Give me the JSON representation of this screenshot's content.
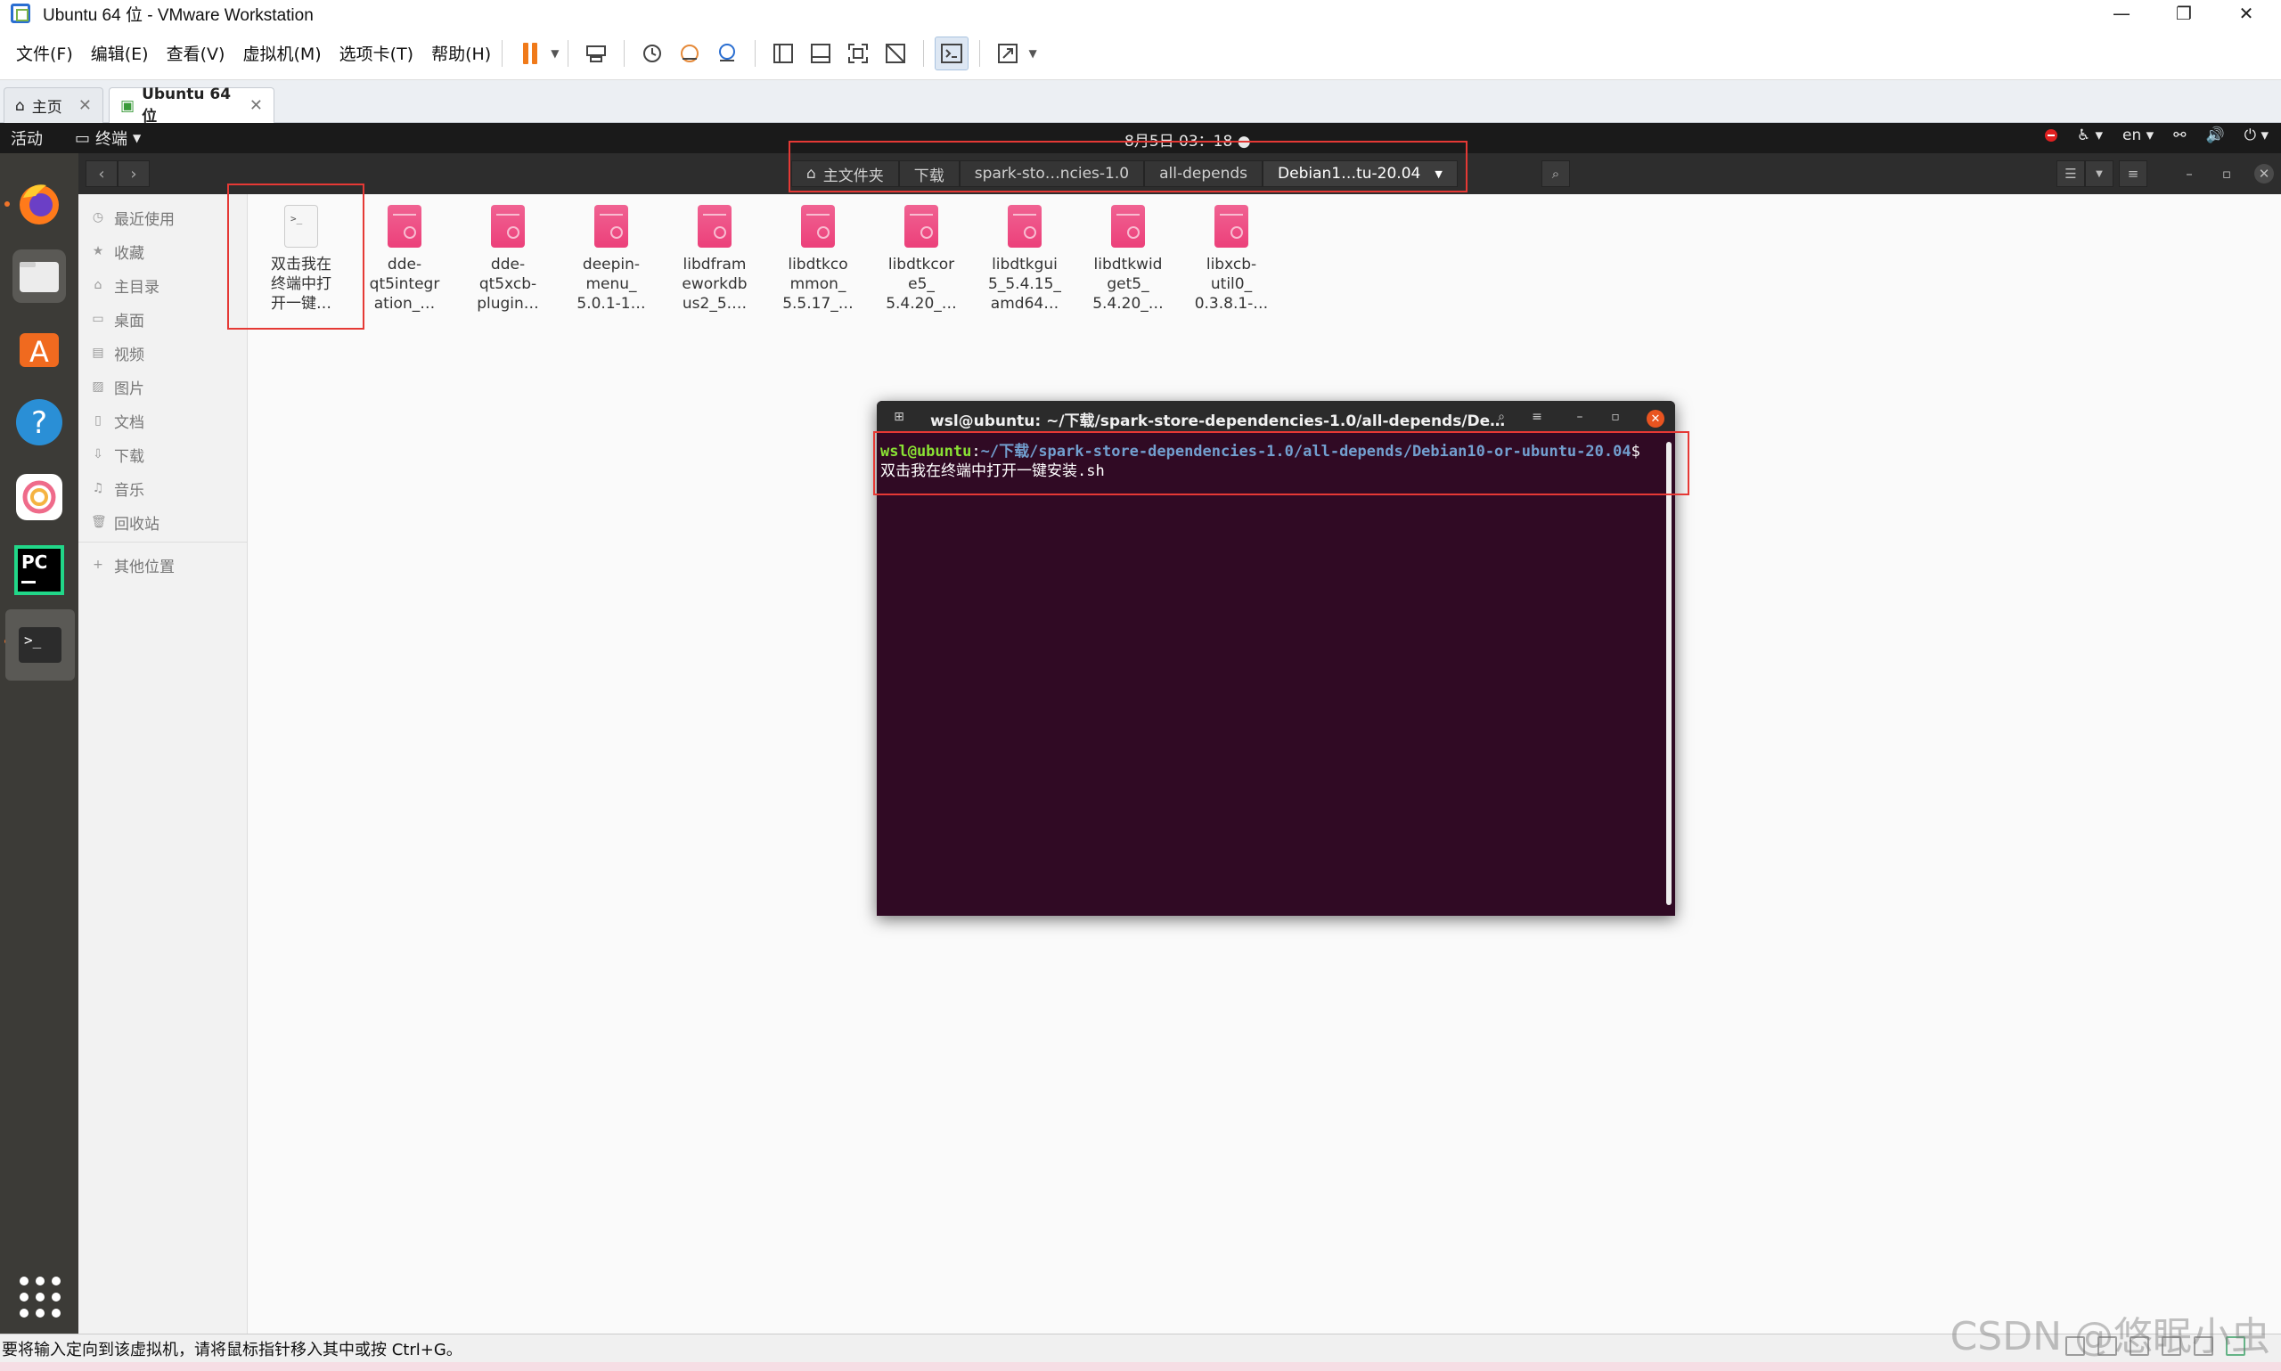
{
  "window": {
    "title": "Ubuntu 64 位 - VMware Workstation",
    "controls": [
      "—",
      "❐",
      "✕"
    ]
  },
  "menubar": {
    "items": [
      "文件(F)",
      "编辑(E)",
      "查看(V)",
      "虚拟机(M)",
      "选项卡(T)",
      "帮助(H)"
    ]
  },
  "tabs": [
    {
      "label": "主页",
      "close": "✕"
    },
    {
      "label": "Ubuntu 64 位",
      "close": "✕"
    }
  ],
  "gnome": {
    "activities": "活动",
    "app_menu": "终端",
    "clock": "8月5日  03：18",
    "lang": "en"
  },
  "nautilus": {
    "breadcrumbs": [
      "主文件夹",
      "下载",
      "spark-sto…ncies-1.0",
      "all-depends",
      "Debian1…tu-20.04"
    ],
    "sidebar": [
      {
        "label": "最近使用",
        "icon": "clock-icon"
      },
      {
        "label": "收藏",
        "icon": "star-icon"
      },
      {
        "label": "主目录",
        "icon": "home-icon"
      },
      {
        "label": "桌面",
        "icon": "desktop-icon"
      },
      {
        "label": "视频",
        "icon": "video-icon"
      },
      {
        "label": "图片",
        "icon": "image-icon"
      },
      {
        "label": "文档",
        "icon": "document-icon"
      },
      {
        "label": "下载",
        "icon": "download-icon"
      },
      {
        "label": "音乐",
        "icon": "music-icon"
      },
      {
        "label": "回收站",
        "icon": "trash-icon"
      },
      {
        "label": "其他位置",
        "icon": "plus-icon"
      }
    ],
    "files": [
      {
        "lines": [
          "双击我在",
          "终端中打",
          "开一键…"
        ],
        "type": "script"
      },
      {
        "lines": [
          "dde-",
          "qt5integr",
          "ation_…"
        ],
        "type": "pkg"
      },
      {
        "lines": [
          "dde-",
          "qt5xcb-",
          "plugin…"
        ],
        "type": "pkg"
      },
      {
        "lines": [
          "deepin-",
          "menu_",
          "5.0.1-1…"
        ],
        "type": "pkg"
      },
      {
        "lines": [
          "libdfram",
          "eworkdb",
          "us2_5.…"
        ],
        "type": "pkg"
      },
      {
        "lines": [
          "libdtkco",
          "mmon_",
          "5.5.17_…"
        ],
        "type": "pkg"
      },
      {
        "lines": [
          "libdtkcor",
          "e5_",
          "5.4.20_…"
        ],
        "type": "pkg"
      },
      {
        "lines": [
          "libdtkgui",
          "5_5.4.15_",
          "amd64…"
        ],
        "type": "pkg"
      },
      {
        "lines": [
          "libdtkwid",
          "get5_",
          "5.4.20_…"
        ],
        "type": "pkg"
      },
      {
        "lines": [
          "libxcb-",
          "util0_",
          "0.3.8.1-…"
        ],
        "type": "pkg"
      }
    ]
  },
  "terminal": {
    "title": "wsl@ubuntu: ~/下载/spark-store-dependencies-1.0/all-depends/De…",
    "prompt_user": "wsl@ubuntu",
    "prompt_sep": ":",
    "prompt_path": "~/下载/spark-store-dependencies-1.0/all-depends/Debian10-or-ubuntu-20.04",
    "prompt_symbol": "$ ",
    "command": "双击我在终端中打开一键安装.sh"
  },
  "status": {
    "text": "要将输入定向到该虚拟机，请将鼠标指针移入其中或按 Ctrl+G。",
    "watermark": "CSDN @悠眠小虫"
  }
}
